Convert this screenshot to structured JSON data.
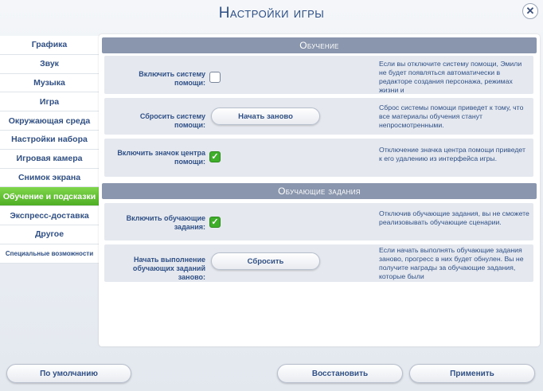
{
  "window": {
    "title": "Настройки игры"
  },
  "close_button": {
    "glyph": "✕"
  },
  "sidebar": {
    "items": [
      {
        "label": "Графика"
      },
      {
        "label": "Звук"
      },
      {
        "label": "Музыка"
      },
      {
        "label": "Игра"
      },
      {
        "label": "Окружающая среда"
      },
      {
        "label": "Настройки набора"
      },
      {
        "label": "Игровая камера"
      },
      {
        "label": "Снимок экрана"
      },
      {
        "label": "Обучение и подсказки"
      },
      {
        "label": "Экспресс-доставка"
      },
      {
        "label": "Другое"
      },
      {
        "label": "Специальные возможности"
      }
    ],
    "active_index": 8,
    "active_color": "#5dbd30"
  },
  "sections": {
    "training": {
      "header": "Обучение",
      "rows": {
        "help_system": {
          "label": "Включить систему помощи:",
          "checked": false,
          "description": "Если вы отключите систему помощи, Эмили не будет появляться автоматически в редакторе создания персонажа, режимах жизни и"
        },
        "reset_help": {
          "label": "Сбросить систему помощи:",
          "button": "Начать заново",
          "description": "Сброс системы помощи приведет к тому, что все материалы обучения станут непросмотренными."
        },
        "help_icon": {
          "label": "Включить значок центра помощи:",
          "checked": true,
          "description": "Отключение значка центра помощи приведет к его удалению из интерфейса игры."
        }
      }
    },
    "tutorial_tasks": {
      "header": "Обучающие задания",
      "rows": {
        "enable_tasks": {
          "label": "Включить обучающие задания:",
          "checked": true,
          "description": "Отключив обучающие задания, вы не сможете реализовывать обучающие сценарии."
        },
        "restart_tasks": {
          "label": "Начать выполнение обучающих заданий заново:",
          "button": "Сбросить",
          "description": "Если начать выполнять обучающие задания заново, прогресс в них будет обнулен. Вы не получите награды за обучающие задания, которые были"
        }
      }
    }
  },
  "footer": {
    "defaults_button": "По умолчанию",
    "restore_button": "Восстановить",
    "apply_button": "Применить"
  }
}
